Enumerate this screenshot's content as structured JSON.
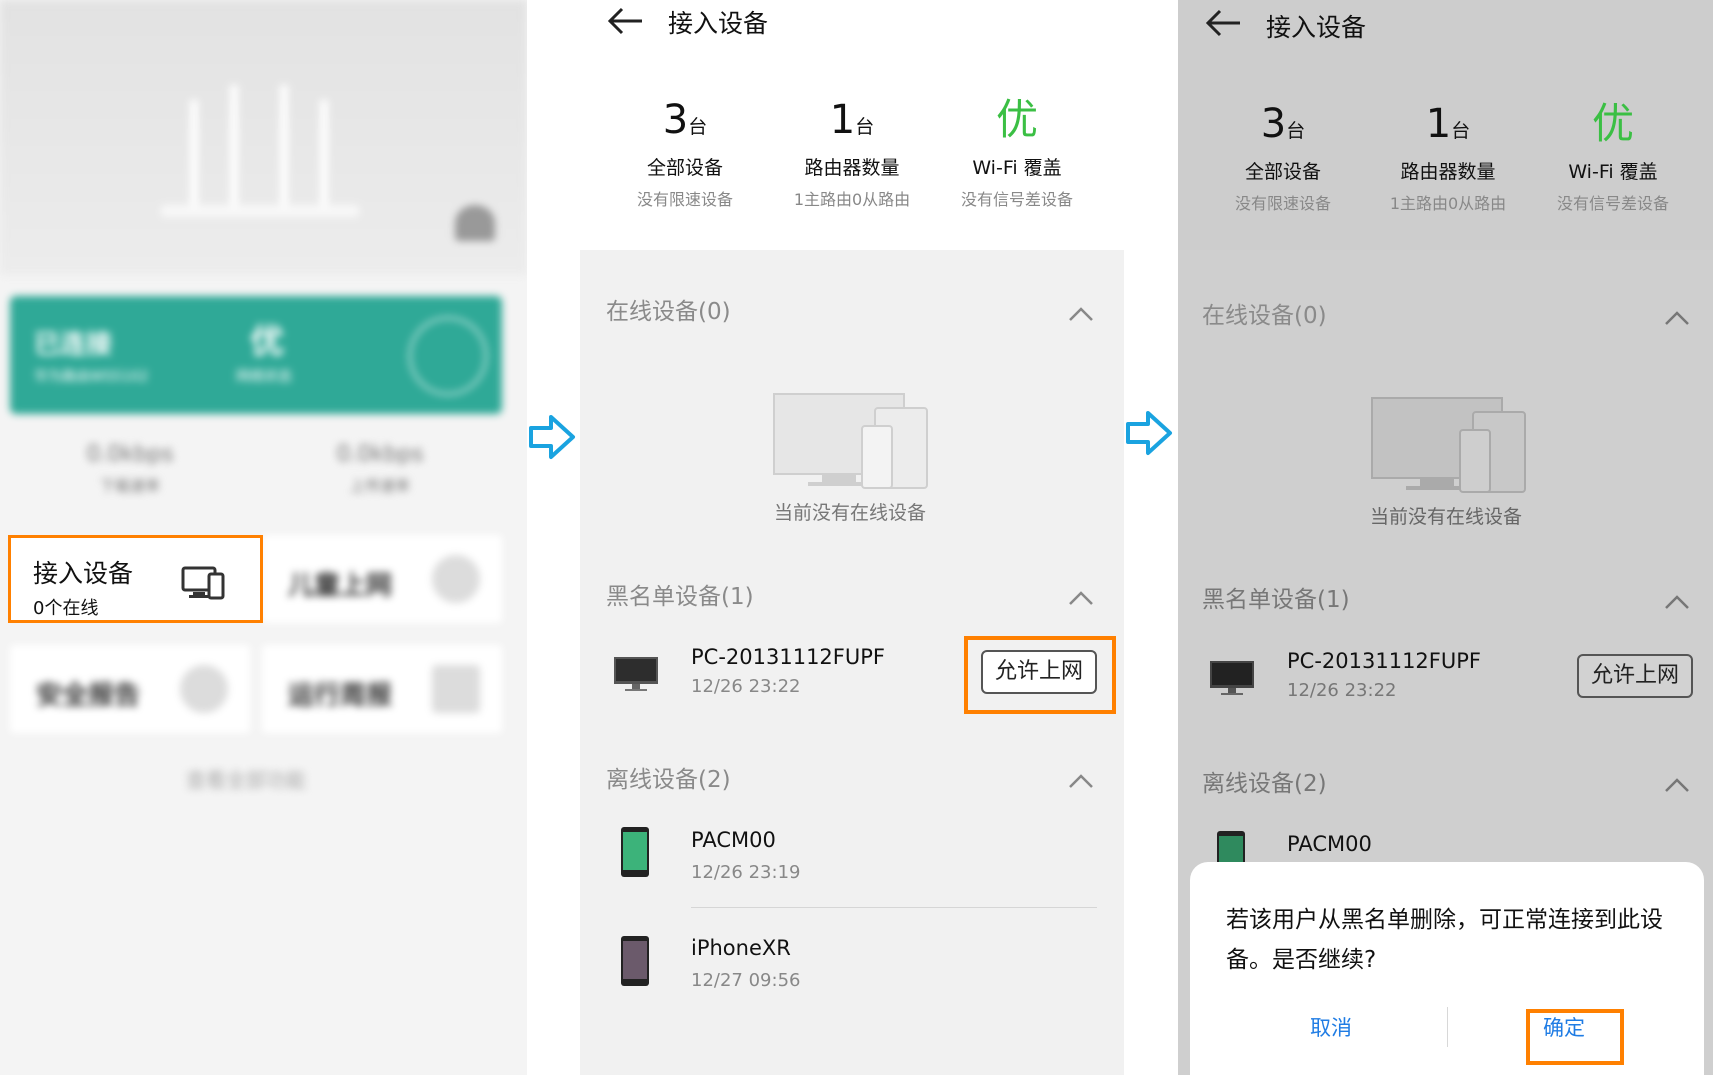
{
  "home": {
    "connected_title": "已连接",
    "connected_sub": "华为路由WS5102",
    "quality": "优",
    "quality_sub": "网络状态",
    "down_speed": "0.0kbps",
    "down_label": "下载速率",
    "up_speed": "0.0kbps",
    "up_label": "上传速率",
    "access_title": "接入设备",
    "access_sub": "0个在线",
    "tiles": [
      "儿童上网",
      "安全报告",
      "运行周报"
    ],
    "footer": "查看全部功能"
  },
  "device_screen": {
    "title": "接入设备",
    "stats": [
      {
        "num": "3",
        "unit": "台",
        "label": "全部设备",
        "sub": "没有限速设备"
      },
      {
        "num": "1",
        "unit": "台",
        "label": "路由器数量",
        "sub": "1主路由0从路由"
      },
      {
        "num": "优",
        "unit": "",
        "label": "Wi-Fi 覆盖",
        "sub": "没有信号差设备"
      }
    ],
    "online_title": "在线设备(0)",
    "empty_text": "当前没有在线设备",
    "blacklist_title": "黑名单设备(1)",
    "blacklist_device": {
      "name": "PC-20131112FUPF",
      "time": "12/26 23:22"
    },
    "allow_label": "允许上网",
    "offline_title": "离线设备(2)",
    "offline_devices": [
      {
        "name": "PACM00",
        "time": "12/26 23:19"
      },
      {
        "name": "iPhoneXR",
        "time": "12/27 09:56"
      }
    ]
  },
  "dialog": {
    "message": "若该用户从黑名单删除，可正常连接到此设备。是否继续?",
    "cancel": "取消",
    "confirm": "确定"
  },
  "colors": {
    "highlight": "#ff8000",
    "good": "#3bbf44",
    "link": "#1f7ce4",
    "teal": "#2fa997",
    "arrow": "#1aa3e0"
  }
}
